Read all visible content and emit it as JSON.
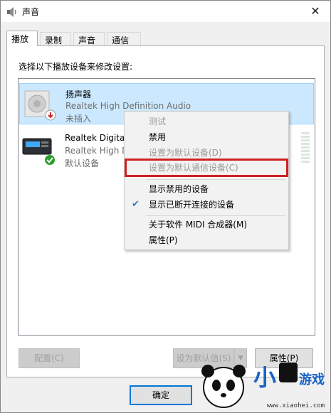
{
  "window": {
    "title": "声音",
    "close_glyph": "✕"
  },
  "tabs": [
    {
      "label": "播放",
      "active": true
    },
    {
      "label": "录制",
      "active": false
    },
    {
      "label": "声音",
      "active": false
    },
    {
      "label": "通信",
      "active": false
    }
  ],
  "instruction": "选择以下播放设备来修改设置:",
  "devices": [
    {
      "name": "扬声器",
      "driver": "Realtek High Definition Audio",
      "status": "未插入",
      "icon": "speaker-icon",
      "badge": "unplugged-badge-icon"
    },
    {
      "name": "Realtek Digital",
      "driver": "Realtek High D",
      "status": "默认设备",
      "icon": "digital-output-icon",
      "badge": "default-check-icon"
    }
  ],
  "context_menu": {
    "items": [
      {
        "label": "测试",
        "enabled": false
      },
      {
        "label": "禁用",
        "enabled": true
      },
      {
        "label": "设置为默认设备(D)",
        "enabled": false
      },
      {
        "label": "设置为默认通信设备(C)",
        "enabled": false,
        "highlighted": true
      },
      {
        "label": "显示禁用的设备",
        "enabled": true
      },
      {
        "label": "显示已断开连接的设备",
        "enabled": true,
        "checked": true
      },
      {
        "label": "关于软件 MIDI 合成器(M)",
        "enabled": true
      },
      {
        "label": "属性(P)",
        "enabled": true
      }
    ],
    "highlight_color": "#d21f1f"
  },
  "buttons": {
    "configure": "配置(C)",
    "set_default": "设为默认值(S)",
    "properties": "属性(P)",
    "ok": "确定"
  },
  "watermark": {
    "brand_a": "小",
    "brand_b": "游戏",
    "url": "www.xiaohei.com"
  },
  "colors": {
    "accent": "#0078d7",
    "selection": "#cce8ff",
    "check_green": "#2e9d2e"
  }
}
